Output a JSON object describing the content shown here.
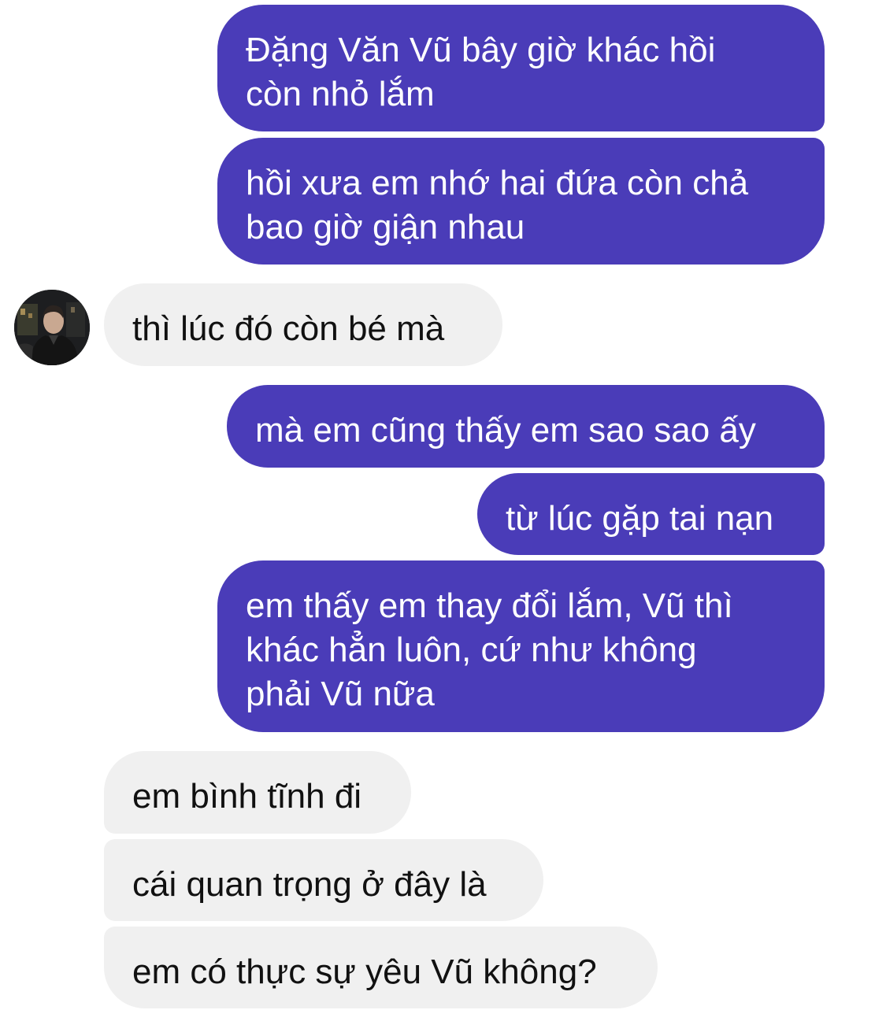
{
  "messages": [
    {
      "side": "sent",
      "text": "Đặng Văn Vũ bây giờ khác hồi\ncòn nhỏ lắm"
    },
    {
      "side": "sent",
      "text": "hồi xưa em nhớ hai đứa còn chả\nbao giờ giận nhau"
    },
    {
      "side": "received",
      "text": "thì lúc đó còn bé mà"
    },
    {
      "side": "sent",
      "text": "mà em cũng thấy em sao sao ấy"
    },
    {
      "side": "sent",
      "text": "từ lúc gặp tai nạn"
    },
    {
      "side": "sent",
      "text": "em thấy em thay đổi lắm, Vũ thì\nkhác hẳn luôn, cứ như không\nphải Vũ nữa"
    },
    {
      "side": "received",
      "text": "em bình tĩnh đi"
    },
    {
      "side": "received",
      "text": "cái quan trọng ở đây là"
    },
    {
      "side": "received",
      "text": "em có thực sự yêu Vũ không?"
    }
  ],
  "colors": {
    "sent_bubble": "#4a3cb8",
    "received_bubble": "#f0f0f0",
    "sent_text": "#ffffff",
    "received_text": "#111111"
  },
  "contact": {
    "avatar_icon": "contact-avatar-photo"
  }
}
